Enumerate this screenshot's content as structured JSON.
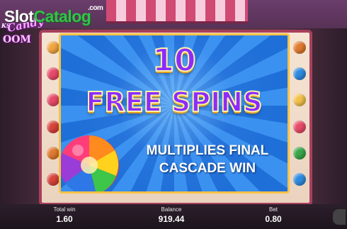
{
  "watermark": {
    "brand_slot": "Slot",
    "brand_catalog": "Catalog",
    "brand_tld": ".com"
  },
  "game_logo": {
    "corner_text": "KS",
    "line1": "Candy",
    "line2": "OOM"
  },
  "popup": {
    "count": "10",
    "title": "FREE SPINS",
    "message_line1": "MULTIPLIES FINAL",
    "message_line2": "CASCADE WIN"
  },
  "hud": {
    "total_win_label": "Total win",
    "total_win_value": "1.60",
    "balance_label": "Balance",
    "balance_value": "919.44",
    "bet_label": "Bet",
    "bet_value": "0.80"
  },
  "colors": {
    "popup_border": "#f7c244",
    "popup_bg": "#1f6fd8",
    "title_fill": "#8c2bff",
    "title_outline": "#fff3a6",
    "watermark_green": "#34c34a"
  },
  "icons": [
    "lollipop-icon",
    "settings-icon",
    "candy-icon"
  ]
}
